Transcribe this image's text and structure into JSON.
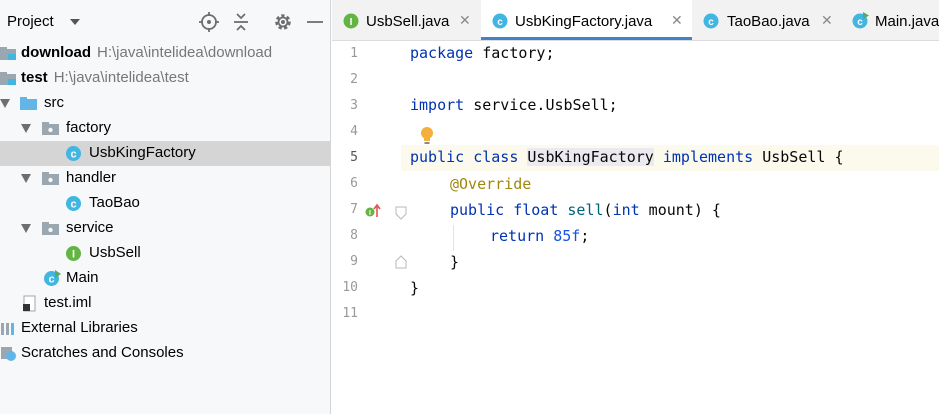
{
  "project": {
    "title": "Project",
    "tree": [
      {
        "name": "download",
        "path": "H:\\java\\intelidea\\download",
        "bold": true
      },
      {
        "name": "test",
        "path": "H:\\java\\intelidea\\test",
        "bold": true
      },
      {
        "name": "src"
      },
      {
        "name": "factory"
      },
      {
        "name": "UsbKingFactory",
        "selected": true
      },
      {
        "name": "handler"
      },
      {
        "name": "TaoBao"
      },
      {
        "name": "service"
      },
      {
        "name": "UsbSell"
      },
      {
        "name": "Main"
      },
      {
        "name": "test.iml"
      },
      {
        "name": "External Libraries"
      },
      {
        "name": "Scratches and Consoles"
      }
    ]
  },
  "tabs": [
    {
      "label": "UsbSell.java",
      "icon": "interface-icon"
    },
    {
      "label": "UsbKingFactory.java",
      "icon": "class-icon",
      "active": true
    },
    {
      "label": "TaoBao.java",
      "icon": "class-icon"
    },
    {
      "label": "Main.java",
      "icon": "main-class-icon"
    }
  ],
  "close_glyph": "✕",
  "editor": {
    "line_numbers": [
      "1",
      "2",
      "3",
      "4",
      "5",
      "6",
      "7",
      "8",
      "9",
      "10",
      "11"
    ],
    "current_line": "5",
    "code": {
      "l1_kw": "package",
      "l1_rest": " factory;",
      "l3_kw": "import",
      "l3_rest": " service.UsbSell;",
      "l5_kw1": "public class ",
      "l5_name": "UsbKingFactory",
      "l5_kw2": " implements",
      "l5_rest": " UsbSell {",
      "l6_ann": "@Override",
      "l7_kw": "public float ",
      "l7_fn": "sell",
      "l7_p": "(",
      "l7_kw2": "int",
      "l7_rest": " mount) {",
      "l8_kw": "return ",
      "l8_num": "85f",
      "l8_rest": ";",
      "l9": "}",
      "l10": "}"
    }
  },
  "colors": {
    "keyword": "#0033b3",
    "annotation": "#9e880d",
    "number": "#1750eb",
    "tab_underline": "#4083c9"
  }
}
